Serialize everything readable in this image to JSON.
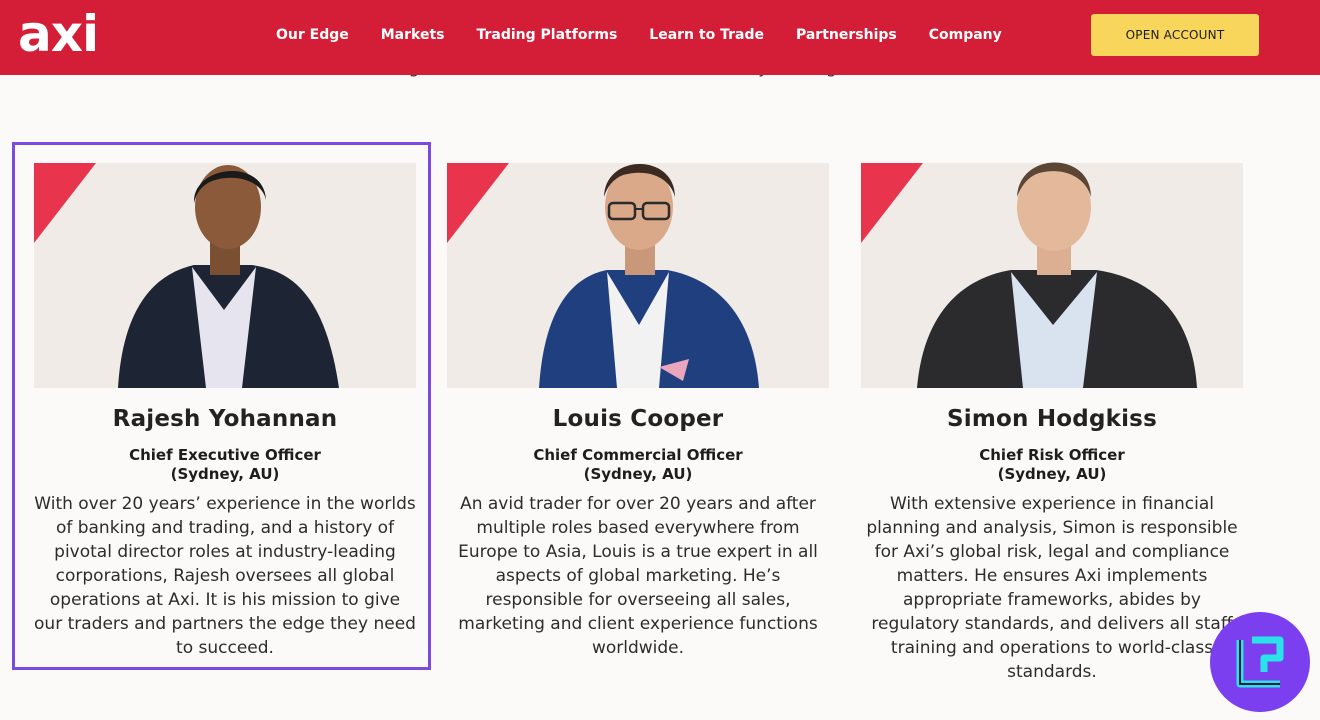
{
  "header": {
    "logo_text": "axi",
    "nav": [
      "Our Edge",
      "Markets",
      "Trading Platforms",
      "Learn to Trade",
      "Partnerships",
      "Company"
    ],
    "cta_label": "OPEN ACCOUNT"
  },
  "intro": "working behind the scenes to deliver an industry-leading service.",
  "team": [
    {
      "name": "Rajesh Yohannan",
      "role": "Chief Executive Officer",
      "location": "(Sydney, AU)",
      "bio": "With over 20 years’ experience in the worlds of banking and trading, and a history of pivotal director roles at industry-leading corporations, Rajesh oversees all global operations at Axi. It is his mission to give our traders and partners the edge they need to succeed."
    },
    {
      "name": "Louis Cooper",
      "role": "Chief Commercial Officer",
      "location": "(Sydney, AU)",
      "bio": "An avid trader for over 20 years and after multiple roles based everywhere from Europe to Asia, Louis is a true expert in all aspects of global marketing. He’s responsible for overseeing all sales, marketing and client experience functions worldwide."
    },
    {
      "name": "Simon Hodgkiss",
      "role": "Chief Risk Officer",
      "location": "(Sydney, AU)",
      "bio": "With extensive experience in financial planning and analysis, Simon is responsible for Axi’s global risk, legal and compliance matters. He ensures Axi implements appropriate frameworks, abides by regulatory standards, and delivers all staff training and operations to world-class standards."
    }
  ],
  "colors": {
    "header_bg": "#d41e37",
    "cta_bg": "#f8d55b",
    "highlight_border": "#7b4be0",
    "accent_triangle": "#e8354d"
  },
  "icons": {
    "watermark": "tradingfinder-logo-icon"
  }
}
